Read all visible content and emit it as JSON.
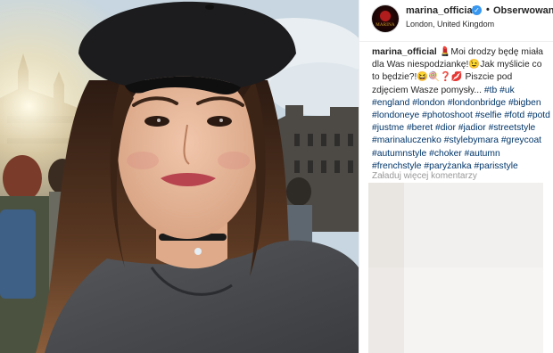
{
  "post": {
    "username": "marina_official",
    "separator": "•",
    "follow_label": "Obserwowanie",
    "location": "London, United Kingdom",
    "avatar_text": "MARINA",
    "caption": {
      "username": "marina_official",
      "text": "💄Moi drodzy będę miała dla Was niespodziankę!😉Jak myślicie co to będzie?!😆🍭❓💋 Piszcie pod zdjęciem Wasze pomysły...",
      "hashtags": [
        "#tb",
        "#uk",
        "#england",
        "#london",
        "#londonbridge",
        "#bigben",
        "#londoneye",
        "#photoshoot",
        "#selfie",
        "#fotd",
        "#potd",
        "#justme",
        "#beret",
        "#dior",
        "#jadior",
        "#streetstyle",
        "#marinaluczenko",
        "#stylebymara",
        "#greycoat",
        "#autumnstyle",
        "#choker",
        "#autumn",
        "#frenchstyle",
        "#paryżanka",
        "#parisstyle"
      ]
    },
    "load_more_label": "Załaduj więcej komentarzy"
  },
  "icons": {
    "verified": "verified-badge-icon"
  },
  "colors": {
    "hashtag": "#003569",
    "verified": "#3897f0",
    "muted": "#999999"
  }
}
